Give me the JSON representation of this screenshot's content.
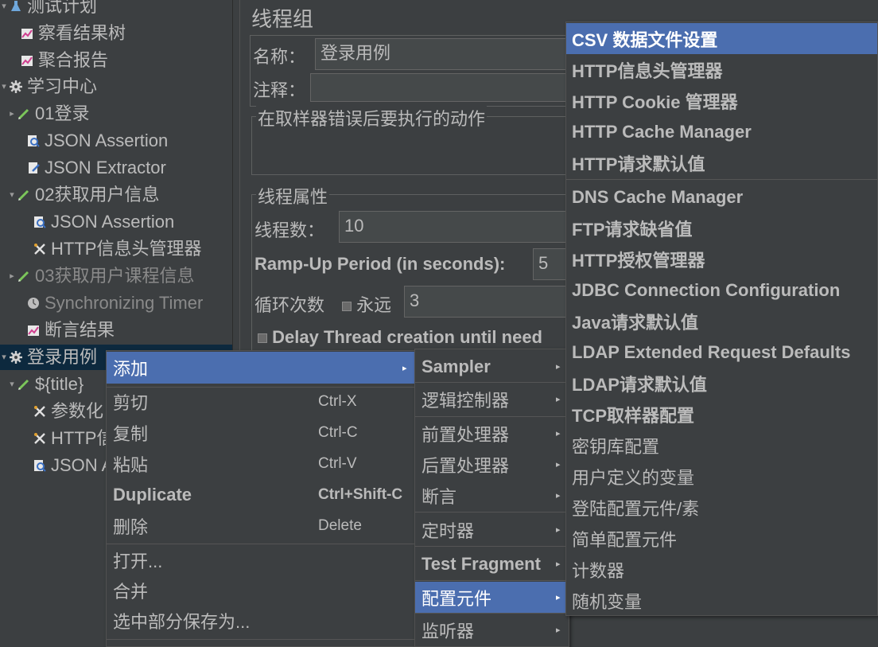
{
  "tree": {
    "items": [
      {
        "label": "测试计划",
        "icon": "test-plan-icon",
        "toggle": "▾"
      },
      {
        "label": "察看结果树",
        "icon": "listener-icon",
        "toggle": ""
      },
      {
        "label": "聚合报告",
        "icon": "listener-icon",
        "toggle": ""
      },
      {
        "label": "学习中心",
        "icon": "thread-group-gear-icon",
        "toggle": "▾"
      },
      {
        "label": "01登录",
        "icon": "sampler-pencil-icon",
        "toggle": "▸"
      },
      {
        "label": "JSON Assertion",
        "icon": "assertion-magnifier-icon",
        "toggle": ""
      },
      {
        "label": "JSON Extractor",
        "icon": "extractor-icon",
        "toggle": ""
      },
      {
        "label": "02获取用户信息",
        "icon": "sampler-pencil-icon",
        "toggle": "▾"
      },
      {
        "label": "JSON Assertion",
        "icon": "assertion-magnifier-icon",
        "toggle": ""
      },
      {
        "label": "HTTP信息头管理器",
        "icon": "config-wrench-icon",
        "toggle": ""
      },
      {
        "label": "03获取用户课程信息",
        "icon": "sampler-pencil-icon",
        "toggle": "▸"
      },
      {
        "label": "Synchronizing Timer",
        "icon": "timer-icon",
        "toggle": ""
      },
      {
        "label": "断言结果",
        "icon": "listener-icon",
        "toggle": ""
      },
      {
        "label": "登录用例",
        "icon": "thread-group-gear-icon",
        "toggle": "▾"
      },
      {
        "label": "${title}",
        "icon": "sampler-pencil-icon",
        "toggle": "▾"
      },
      {
        "label": "参数化",
        "icon": "config-wrench-icon",
        "toggle": ""
      },
      {
        "label": "HTTP信",
        "icon": "config-wrench-icon",
        "toggle": ""
      },
      {
        "label": "JSON A",
        "icon": "assertion-magnifier-icon",
        "toggle": ""
      }
    ]
  },
  "main": {
    "title": "线程组",
    "name_label": "名称：",
    "name_value": "登录用例",
    "comment_label": "注释：",
    "on_error_legend": "在取样器错误后要执行的动作",
    "thread_props_legend": "线程属性",
    "threads_label": "线程数：",
    "threads_value": "10",
    "rampup_label": "Ramp-Up Period (in seconds):",
    "rampup_value": "5",
    "loop_label": "循环次数",
    "forever_label": "永远",
    "loop_value": "3",
    "delay_label": "Delay Thread creation until need"
  },
  "context_menu": {
    "add": "添加",
    "items": [
      {
        "label": "剪切",
        "accel": "Ctrl-X"
      },
      {
        "label": "复制",
        "accel": "Ctrl-C"
      },
      {
        "label": "粘贴",
        "accel": "Ctrl-V"
      },
      {
        "label": "Duplicate",
        "accel": "Ctrl+Shift-C"
      },
      {
        "label": "删除",
        "accel": "Delete"
      }
    ],
    "open": "打开...",
    "merge": "合并",
    "save_selection": "选中部分保存为..."
  },
  "add_submenu": {
    "items": [
      {
        "label": "Sampler"
      },
      {
        "label": "逻辑控制器"
      },
      {
        "label": "前置处理器"
      },
      {
        "label": "后置处理器"
      },
      {
        "label": "断言"
      },
      {
        "label": "定时器"
      },
      {
        "label": "Test Fragment"
      },
      {
        "label": "配置元件"
      },
      {
        "label": "监听器"
      }
    ]
  },
  "config_submenu": {
    "items": [
      "CSV 数据文件设置",
      "HTTP信息头管理器",
      "HTTP Cookie 管理器",
      "HTTP Cache Manager",
      "HTTP请求默认值",
      "DNS Cache Manager",
      "FTP请求缺省值",
      "HTTP授权管理器",
      "JDBC Connection Configuration",
      "Java请求默认值",
      "LDAP Extended Request Defaults",
      "LDAP请求默认值",
      "TCP取样器配置",
      "密钥库配置",
      "用户定义的变量",
      "登陆配置元件/素",
      "简单配置元件",
      "计数器",
      "随机变量"
    ]
  },
  "colors": {
    "background": "#3c3f41",
    "highlight": "#4b6eaf",
    "tree_selection": "#0d293e",
    "text": "#bbbbbb"
  }
}
